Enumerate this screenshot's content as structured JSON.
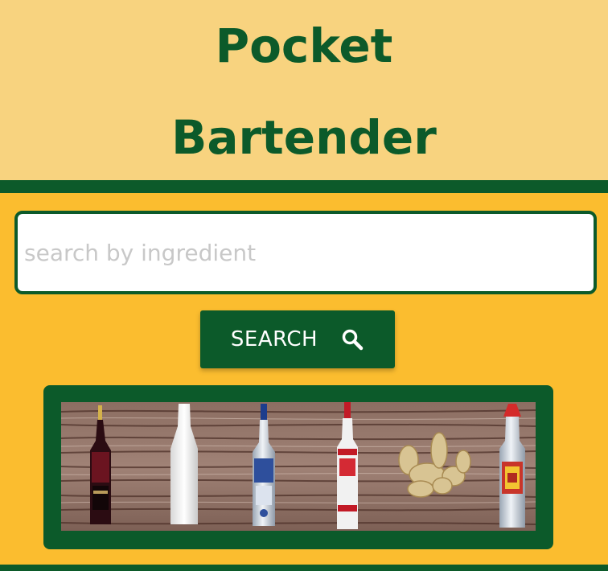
{
  "header": {
    "title_line1": "Pocket",
    "title_line2": "Bartender"
  },
  "search": {
    "placeholder": "search by ingredient",
    "button_label": "SEARCH",
    "button_icon": "search-icon"
  },
  "banner": {
    "items": [
      "dark-liqueur-bottle",
      "white-milk-bottle",
      "blue-vodka-bottle",
      "red-label-vodka-bottle",
      "ginger-root",
      "tequila-bottle"
    ]
  },
  "colors": {
    "primary_green": "#0c5a2a",
    "page_yellow": "#fbbd2f",
    "header_cream": "#f8d37f"
  }
}
